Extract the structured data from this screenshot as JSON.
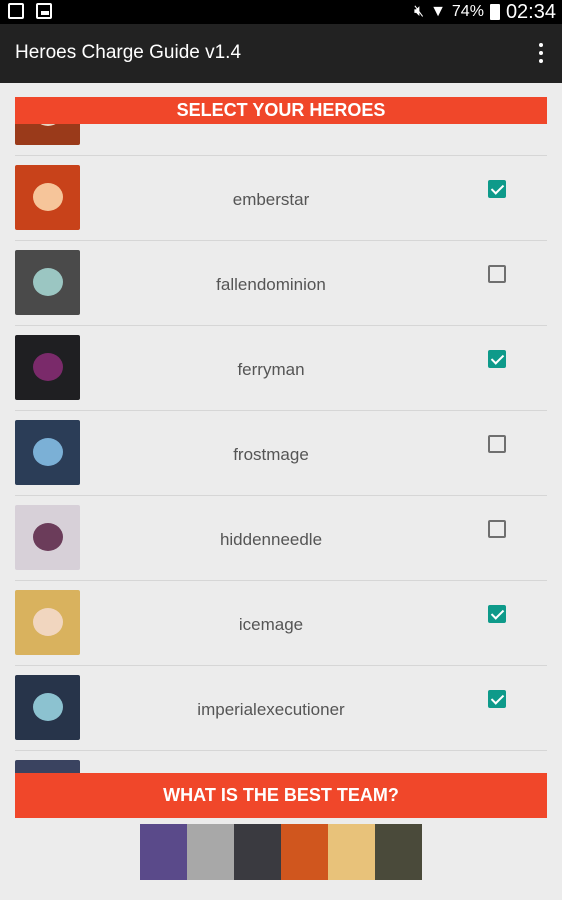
{
  "status_bar": {
    "battery": "74%",
    "time": "02:34"
  },
  "app_bar": {
    "title": "Heroes Charge Guide v1.4"
  },
  "banner": {
    "label": "SELECT YOUR HEROES"
  },
  "heroes": [
    {
      "name": "",
      "checked": false,
      "avatar_bg": "#9a3a1a",
      "face": "#e8d6c2"
    },
    {
      "name": "emberstar",
      "checked": true,
      "avatar_bg": "#c8421a",
      "face": "#f6c59a"
    },
    {
      "name": "fallendominion",
      "checked": false,
      "avatar_bg": "#4a4a4a",
      "face": "#9bc6c2"
    },
    {
      "name": "ferryman",
      "checked": true,
      "avatar_bg": "#1f1f22",
      "face": "#7a2a6a"
    },
    {
      "name": "frostmage",
      "checked": false,
      "avatar_bg": "#2b3d57",
      "face": "#7bb0d6"
    },
    {
      "name": "hiddenneedle",
      "checked": false,
      "avatar_bg": "#d7d0d8",
      "face": "#6b3c5a"
    },
    {
      "name": "icemage",
      "checked": true,
      "avatar_bg": "#d9b25e",
      "face": "#f1d6bf"
    },
    {
      "name": "imperialexecutioner",
      "checked": true,
      "avatar_bg": "#27344a",
      "face": "#8cc2d0"
    },
    {
      "name": "",
      "checked": false,
      "avatar_bg": "#3a4360",
      "face": "#6a7aa0"
    }
  ],
  "best_team_button": {
    "label": "WHAT IS THE BEST TEAM?"
  },
  "team_strip": [
    "#5a4a8a",
    "#a8a8a8",
    "#3a3a40",
    "#d0561e",
    "#e8c27a",
    "#4a4a3a"
  ]
}
